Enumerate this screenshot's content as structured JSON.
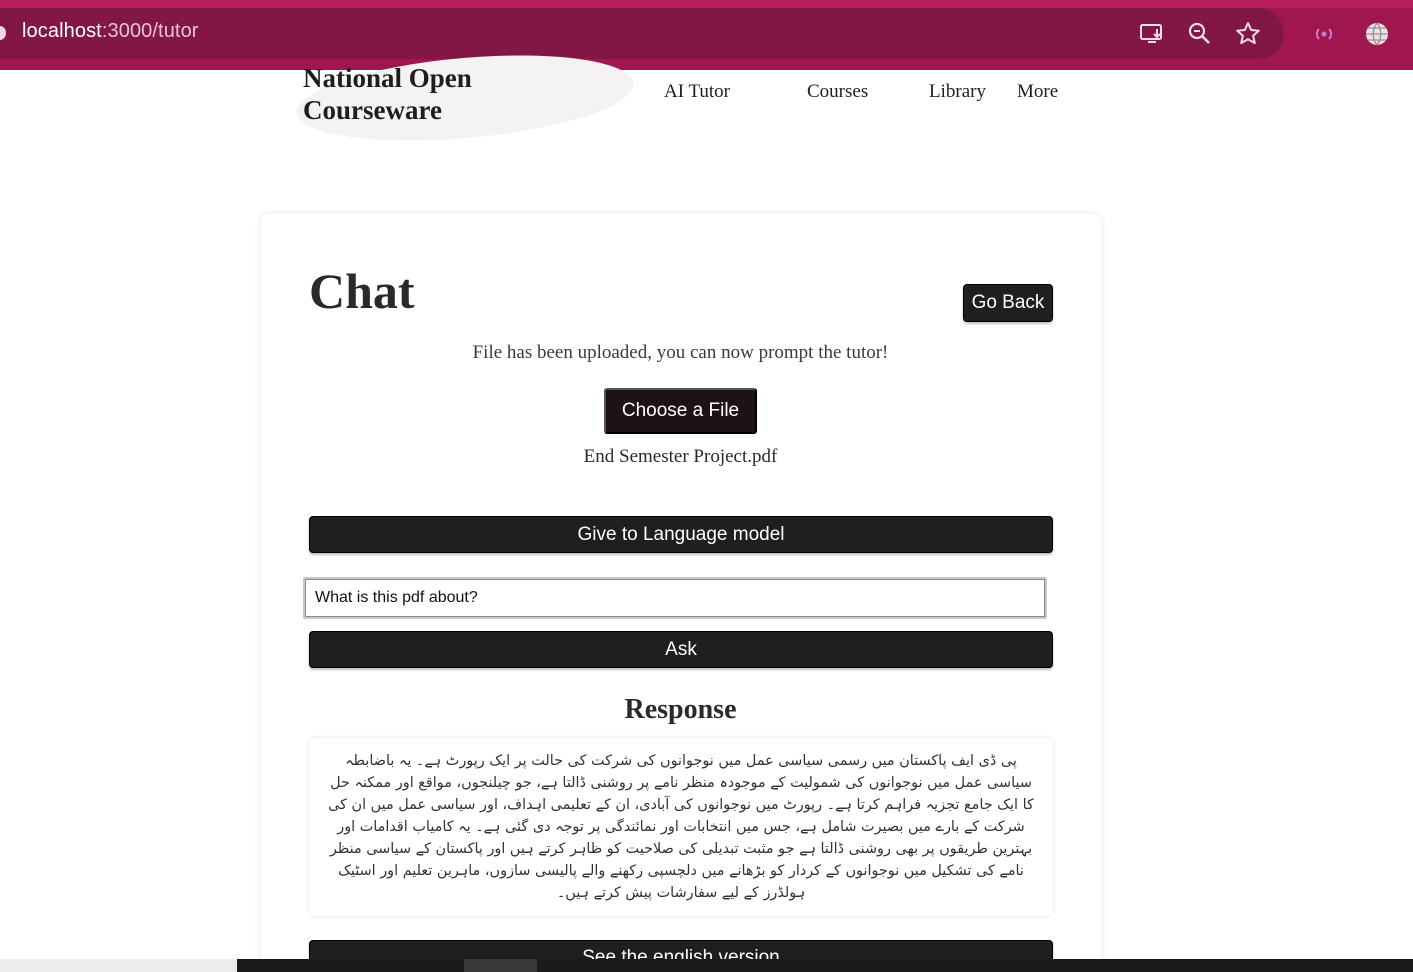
{
  "browser": {
    "url_host": "localhost",
    "url_rest": ":3000/tutor",
    "icons": [
      "install-app-icon",
      "zoom-icon",
      "bookmark-star-icon",
      "broadcast-icon",
      "globe-icon"
    ]
  },
  "site": {
    "brand_line1": "National Open",
    "brand_line2": "Courseware",
    "nav": [
      "AI Tutor",
      "Courses",
      "Library",
      "More"
    ]
  },
  "chat": {
    "title": "Chat",
    "back_label": "Go Back",
    "status": "File has been uploaded, you can now prompt the tutor!",
    "choose_label": "Choose a File",
    "filename": "End Semester Project.pdf",
    "give_label": "Give to Language model",
    "prompt_value": "What is this pdf about?",
    "ask_label": "Ask",
    "response_title": "Response",
    "response_text": "پی ڈی ایف پاکستان میں رسمی سیاسی عمل میں نوجوانوں کی شرکت کی حالت پر ایک رپورٹ ہے۔ یہ باضابطہ سیاسی عمل میں نوجوانوں کی شمولیت کے موجودہ منظر نامے پر روشنی ڈالتا ہے، جو چیلنجوں، مواقع اور ممکنہ حل کا ایک جامع تجزیہ فراہم کرتا ہے۔ رپورٹ میں نوجوانوں کی آبادی، ان کے تعلیمی اہداف، اور سیاسی عمل میں ان کی شرکت کے بارے میں بصیرت شامل ہے، جس میں انتخابات اور نمائندگی پر توجہ دی گئی ہے۔ یہ کامیاب اقدامات اور بہترین طریقوں پر بھی روشنی ڈالتا ہے جو مثبت تبدیلی کی صلاحیت کو ظاہر کرتے ہیں اور پاکستان کے سیاسی منظر نامے کی تشکیل میں نوجوانوں کے کردار کو بڑھانے میں دلچسپی رکھنے والے پالیسی سازوں، ماہرین تعلیم اور اسٹیک ہولڈرز کے لیے سفارشات پیش کرتے ہیں۔",
    "english_label": "See the english version"
  },
  "colors": {
    "chrome": "#a0174f",
    "address_bar": "#821645",
    "button_dark": "#1f1f1f"
  }
}
